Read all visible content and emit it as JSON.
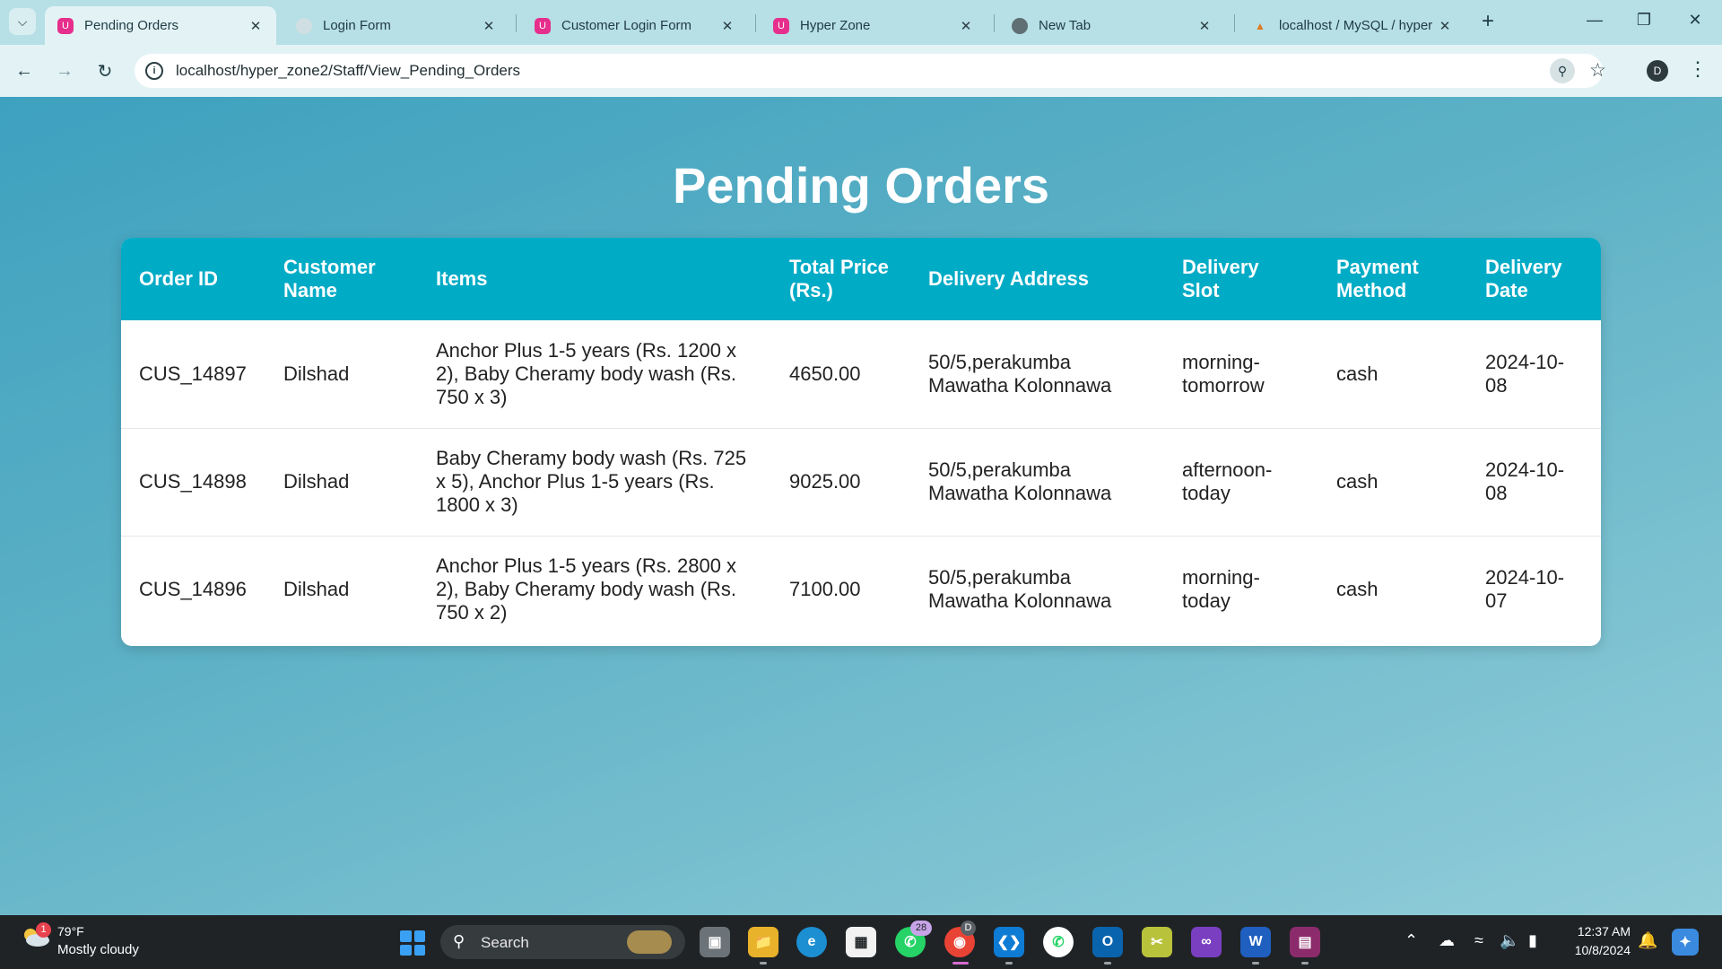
{
  "browser": {
    "tabs": [
      {
        "title": "Pending Orders",
        "icon": "hyperzone-logo-icon",
        "active": true
      },
      {
        "title": "Login Form",
        "icon": "globe-icon",
        "active": false
      },
      {
        "title": "Customer Login Form",
        "icon": "hyperzone-logo-icon",
        "active": false
      },
      {
        "title": "Hyper Zone",
        "icon": "hyperzone-logo-icon",
        "active": false
      },
      {
        "title": "New Tab",
        "icon": "chrome-icon",
        "active": false
      },
      {
        "title": "localhost / MySQL / hyper",
        "icon": "phpmyadmin-icon",
        "active": false
      }
    ],
    "url": "localhost/hyper_zone2/Staff/View_Pending_Orders",
    "profile_initial": "D"
  },
  "page": {
    "title": "Pending Orders"
  },
  "table": {
    "columns": [
      "Order ID",
      "Customer Name",
      "Items",
      "Total Price (Rs.)",
      "Delivery Address",
      "Delivery Slot",
      "Payment Method",
      "Delivery Date"
    ],
    "rows": [
      [
        "CUS_14897",
        "Dilshad",
        "Anchor Plus 1-5 years (Rs. 1200 x 2), Baby Cheramy body wash (Rs. 750 x 3)",
        "4650.00",
        "50/5,perakumba Mawatha Kolonnawa",
        "morning-tomorrow",
        "cash",
        "2024-10-08"
      ],
      [
        "CUS_14898",
        "Dilshad",
        "Baby Cheramy body wash (Rs. 725 x 5), Anchor Plus 1-5 years (Rs. 1800 x 3)",
        "9025.00",
        "50/5,perakumba Mawatha Kolonnawa",
        "afternoon-today",
        "cash",
        "2024-10-08"
      ],
      [
        "CUS_14896",
        "Dilshad",
        "Anchor Plus 1-5 years (Rs. 2800 x 2), Baby Cheramy body wash (Rs. 750 x 2)",
        "7100.00",
        "50/5,perakumba Mawatha Kolonnawa",
        "morning-today",
        "cash",
        "2024-10-07"
      ]
    ]
  },
  "taskbar": {
    "weather_temp": "79°F",
    "weather_desc": "Mostly cloudy",
    "weather_badge": "1",
    "search_label": "Search",
    "whatsapp_badge": "28",
    "chrome_profile": "D",
    "time": "12:37 AM",
    "date": "10/8/2024"
  },
  "colors": {
    "header_bg": "#00abc6",
    "page_gradient_start": "#3ea1bf",
    "page_gradient_end": "#92cdd9",
    "tab_strip": "#b7dfe6"
  }
}
